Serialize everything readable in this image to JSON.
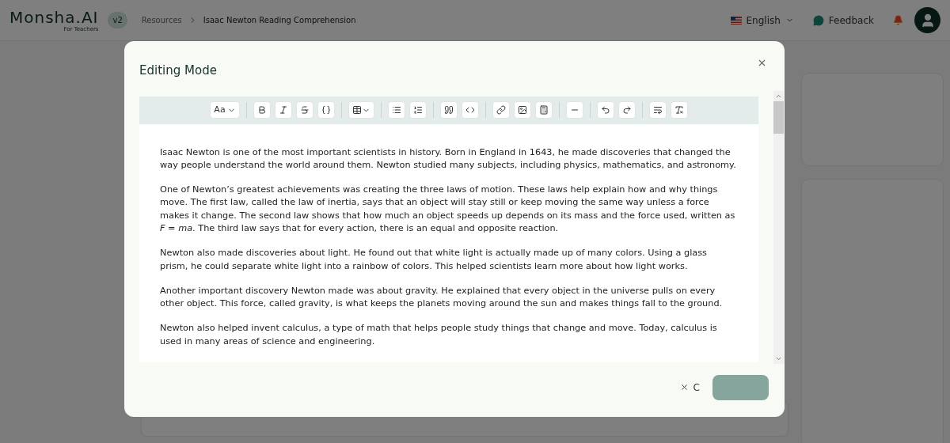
{
  "header": {
    "logo": "Monsha.AI",
    "logo_subtitle": "For Teachers",
    "version_badge": "v2",
    "breadcrumbs": [
      "Resources",
      "Isaac Newton Reading Comprehension"
    ],
    "language": "English",
    "feedback": "Feedback"
  },
  "dialog": {
    "title": "Editing Mode",
    "toolbar": {
      "text_style_label": "Aa"
    },
    "paragraphs": [
      "Isaac Newton is one of the most important scientists in history. Born in England in 1643, he made discoveries that changed the way people understand the world around them. Newton studied many subjects, including physics, mathematics, and astronomy.",
      "One of Newton’s greatest achievements was creating the three laws of motion. These laws help explain how and why things move. The first law, called the law of inertia, says that an object will stay still or keep moving the same way unless a force makes it change. The second law shows that how much an object speeds up depends on its mass and the force used, written as *F* = *ma*. The third law says that for every action, there is an equal and opposite reaction.",
      "Newton also made discoveries about light. He found out that white light is actually made up of many colors. Using a glass prism, he could separate white light into a rainbow of colors. This helped scientists learn more about how light works.",
      "Another important discovery Newton made was about gravity. He explained that every object in the universe pulls on every other object. This force, called gravity, is what keeps the planets moving around the sun and makes things fall to the ground.",
      "Newton also helped invent calculus, a type of math that helps people study things that change and move. Today, calculus is used in many areas of science and engineering."
    ],
    "cancel_label": "C",
    "save_disabled": true
  }
}
